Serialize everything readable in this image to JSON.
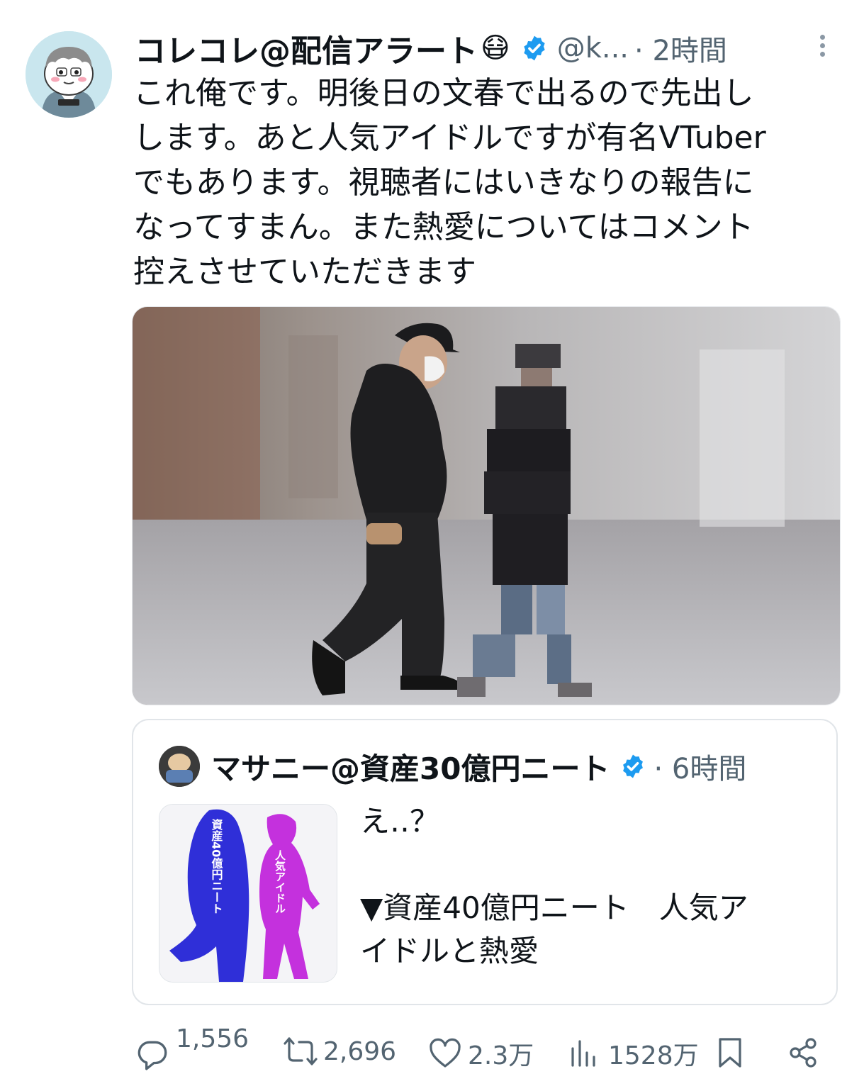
{
  "tweet": {
    "display_name": "コレコレ@配信アラート",
    "emoji": "😷",
    "handle": "@k...",
    "time": "· 2時間",
    "text": "これ俺です。明後日の文春で出るので先出し\nします。あと人気アイドルですが有名VTuber\nでもあります。視聴者にはいきなりの報告に\nなってすまん。また熱愛についてはコメント\n控えさせていただきます"
  },
  "quote": {
    "display_name": "マサニー@資産30億円ニート",
    "time": "· 6時間",
    "text": "え‥？\n\n▼資産40億円ニート　人気ア\nイドルと熱愛",
    "thumb_left_label": "資産40億円ニート",
    "thumb_right_label": "人気アイドル"
  },
  "actions": {
    "replies": "1,556",
    "retweets": "2,696",
    "likes": "2.3万",
    "views": "1528万"
  },
  "colors": {
    "verified": "#1d9bf0",
    "secondary_text": "#536471",
    "thumb_left": "#2f2fd8",
    "thumb_right": "#c431dd"
  }
}
